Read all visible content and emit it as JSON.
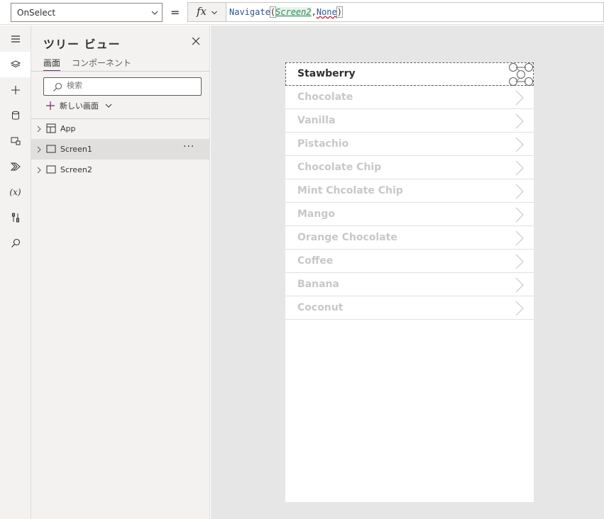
{
  "formula_bar": {
    "property": "OnSelect",
    "equals": "=",
    "fx_label": "fx",
    "formula": {
      "function": "Navigate",
      "open_paren": "(",
      "arg1": "Screen2",
      "comma": ",",
      "arg2": "None",
      "close_paren": ")"
    }
  },
  "left_rail": {
    "items": [
      {
        "icon": "hamburger-menu-icon"
      },
      {
        "icon": "layers-icon",
        "active": true
      },
      {
        "icon": "plus-icon"
      },
      {
        "icon": "database-icon"
      },
      {
        "icon": "media-icon"
      },
      {
        "icon": "power-automate-icon"
      },
      {
        "icon": "variables-icon",
        "text": "(x)"
      },
      {
        "icon": "tools-icon"
      },
      {
        "icon": "search-icon"
      }
    ]
  },
  "tree_panel": {
    "title": "ツリー ビュー",
    "tabs": [
      {
        "label": "画面",
        "active": true
      },
      {
        "label": "コンポーネント",
        "active": false
      }
    ],
    "search_placeholder": "検索",
    "new_screen_label": "新しい画面",
    "nodes": [
      {
        "label": "App",
        "icon": "app-icon",
        "selected": false
      },
      {
        "label": "Screen1",
        "icon": "screen-icon",
        "selected": true,
        "more": "···"
      },
      {
        "label": "Screen2",
        "icon": "screen-icon",
        "selected": false
      }
    ]
  },
  "gallery": {
    "items": [
      "Stawberry",
      "Chocolate",
      "Vanilla",
      "Pistachio",
      "Chocolate Chip",
      "Mint Chcolate Chip",
      "Mango",
      "Orange Chocolate",
      "Coffee",
      "Banana",
      "Coconut"
    ]
  },
  "colors": {
    "accent": "#742774",
    "canvas_bg": "#e6e6e6",
    "muted_text": "#c8c8c8"
  }
}
